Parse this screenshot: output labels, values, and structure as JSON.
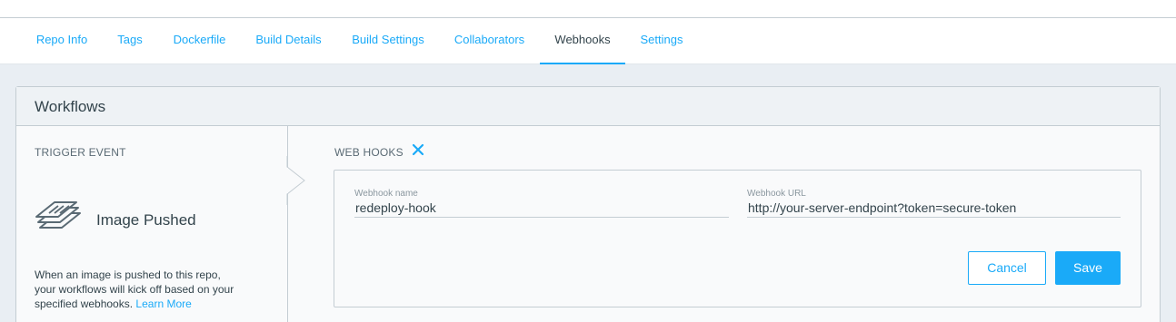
{
  "tabs": [
    {
      "label": "Repo Info"
    },
    {
      "label": "Tags"
    },
    {
      "label": "Dockerfile"
    },
    {
      "label": "Build Details"
    },
    {
      "label": "Build Settings"
    },
    {
      "label": "Collaborators"
    },
    {
      "label": "Webhooks",
      "active": true
    },
    {
      "label": "Settings"
    }
  ],
  "panel": {
    "title": "Workflows",
    "trigger": {
      "section_label": "TRIGGER EVENT",
      "event_name": "Image Pushed",
      "event_icon": "stacked-layers-icon",
      "description": "When an image is pushed to this repo, your workflows will kick off based on your specified webhooks.",
      "learn_more": "Learn More"
    },
    "webhooks": {
      "section_label": "WEB HOOKS",
      "close_icon": "close-icon",
      "name_label": "Webhook name",
      "name_value": "redeploy-hook",
      "url_label": "Webhook URL",
      "url_value": "http://your-server-endpoint?token=secure-token",
      "cancel_label": "Cancel",
      "save_label": "Save"
    }
  },
  "colors": {
    "accent": "#1aaaf8",
    "text": "#33444c",
    "background": "#e9eef3",
    "border": "#c4cdd3"
  }
}
